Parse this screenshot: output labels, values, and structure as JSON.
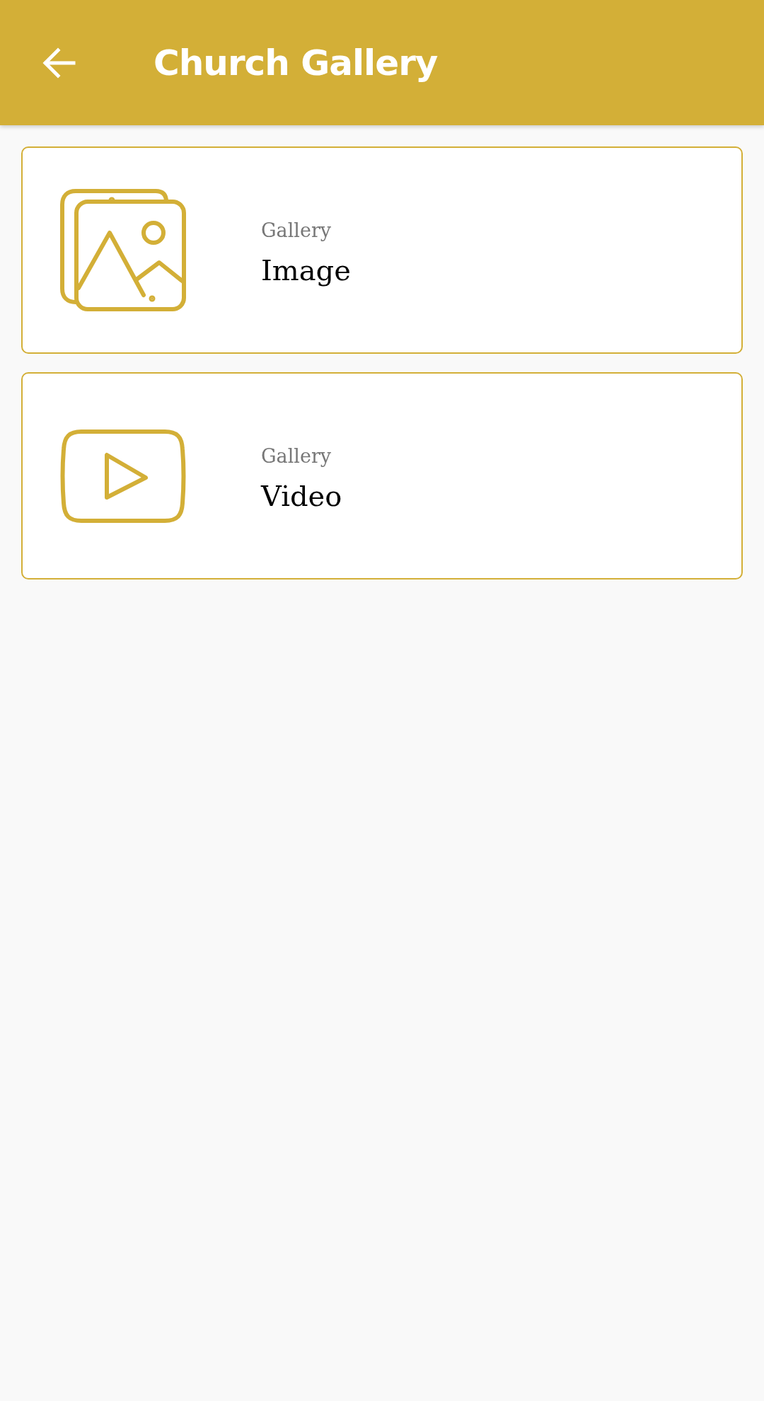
{
  "app_bar": {
    "title": "Church Gallery"
  },
  "items": [
    {
      "kind": "image",
      "subtitle": "Gallery",
      "title": "Image"
    },
    {
      "kind": "video",
      "subtitle": "Gallery",
      "title": "Video"
    }
  ]
}
